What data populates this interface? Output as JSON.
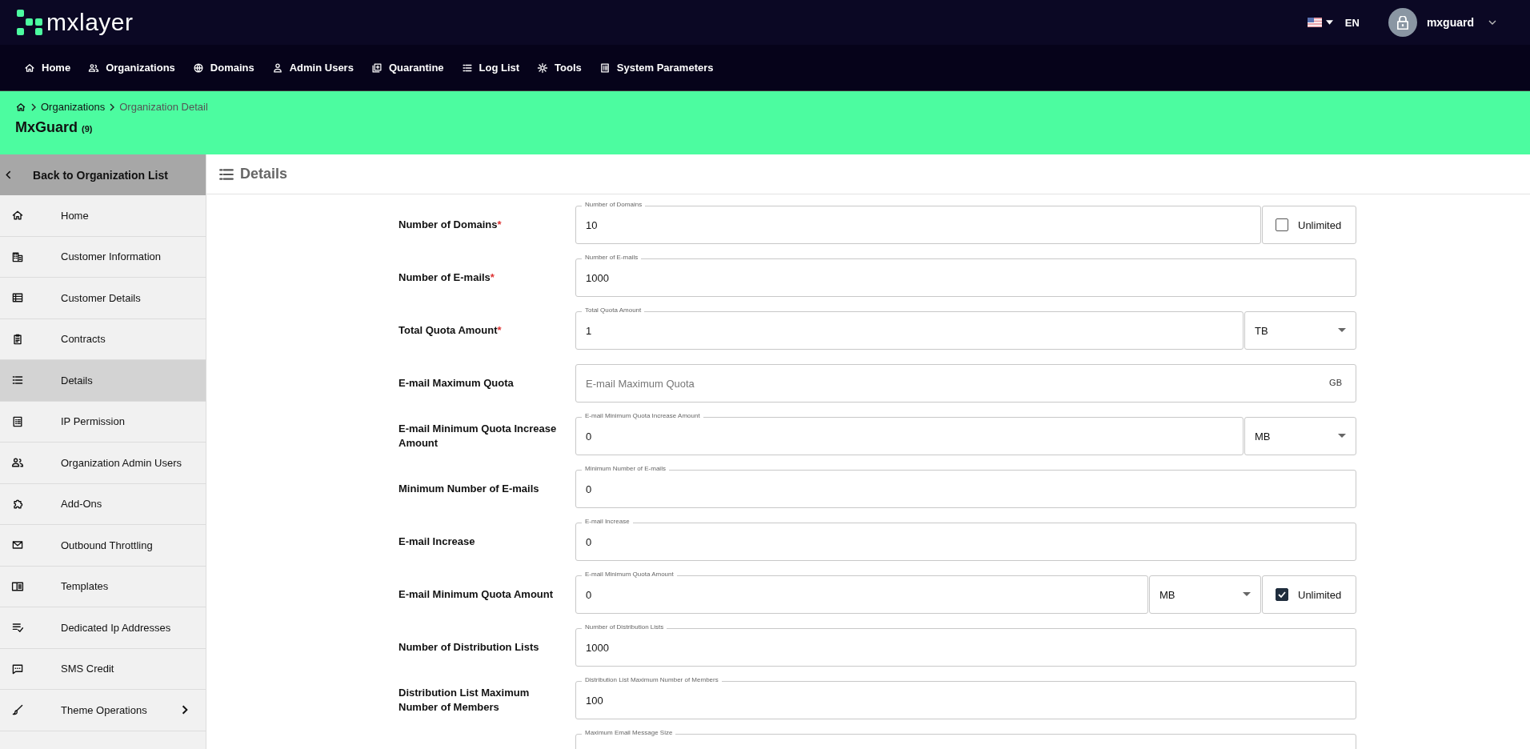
{
  "brand": {
    "name": "mxlayer"
  },
  "header": {
    "language": "EN",
    "user": "mxguard"
  },
  "nav": [
    {
      "label": "Home"
    },
    {
      "label": "Organizations"
    },
    {
      "label": "Domains"
    },
    {
      "label": "Admin Users"
    },
    {
      "label": "Quarantine"
    },
    {
      "label": "Log List"
    },
    {
      "label": "Tools"
    },
    {
      "label": "System Parameters"
    }
  ],
  "breadcrumb": [
    {
      "label": "Organizations",
      "current": false
    },
    {
      "label": "Organization Detail",
      "current": true
    }
  ],
  "page_title": {
    "name": "MxGuard",
    "count": "(9)"
  },
  "sidebar": {
    "back": "Back to Organization List",
    "items": [
      {
        "label": "Home",
        "selected": false
      },
      {
        "label": "Customer Information",
        "selected": false
      },
      {
        "label": "Customer Details",
        "selected": false
      },
      {
        "label": "Contracts",
        "selected": false
      },
      {
        "label": "Details",
        "selected": true
      },
      {
        "label": "IP Permission",
        "selected": false
      },
      {
        "label": "Organization Admin Users",
        "selected": false
      },
      {
        "label": "Add-Ons",
        "selected": false
      },
      {
        "label": "Outbound Throttling",
        "selected": false
      },
      {
        "label": "Templates",
        "selected": false
      },
      {
        "label": "Dedicated Ip Addresses",
        "selected": false
      },
      {
        "label": "SMS Credit",
        "selected": false
      },
      {
        "label": "Theme Operations",
        "selected": false,
        "has_children": true
      }
    ]
  },
  "section_title": "Details",
  "fields": [
    {
      "label": "Number of Domains",
      "required_mark": "*",
      "legend": "Number of Domains",
      "value": "10",
      "checkbox": {
        "label": "Unlimited",
        "checked": false
      }
    },
    {
      "label": "Number of E-mails",
      "required_mark": "*",
      "legend": "Number of E-mails",
      "value": "1000"
    },
    {
      "label": "Total Quota Amount",
      "required_mark": "*",
      "legend": "Total Quota Amount",
      "value": "1",
      "unit_select": "TB"
    },
    {
      "label": "E-mail Maximum Quota",
      "placeholder": "E-mail Maximum Quota",
      "suffix": "GB"
    },
    {
      "label": "E-mail Minimum Quota Increase Amount",
      "legend": "E-mail Minimum Quota Increase Amount",
      "value": "0",
      "unit_select": "MB"
    },
    {
      "label": "Minimum Number of E-mails",
      "legend": "Minimum Number of E-mails",
      "value": "0"
    },
    {
      "label": "E-mail Increase",
      "legend": "E-mail Increase",
      "value": "0"
    },
    {
      "label": "E-mail Minimum Quota Amount",
      "legend": "E-mail Minimum Quota Amount",
      "value": "0",
      "unit_select": "MB",
      "checkbox": {
        "label": "Unlimited",
        "checked": true
      }
    },
    {
      "label": "Number of Distribution Lists",
      "legend": "Number of Distribution Lists",
      "value": "1000"
    },
    {
      "label": "Distribution List Maximum Number of Members",
      "legend": "Distribution List Maximum Number of Members",
      "value": "100"
    },
    {
      "legend": "Maximum Email Message Size"
    }
  ]
}
